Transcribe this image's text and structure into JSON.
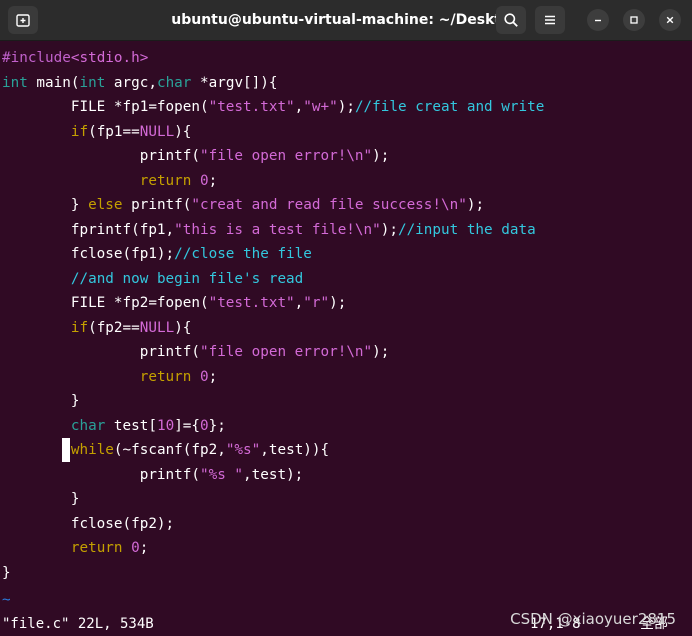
{
  "window": {
    "title": "ubuntu@ubuntu-virtual-machine: ~/Desktop"
  },
  "titlebar_buttons": {
    "new_tab": "new-tab-icon",
    "search": "search-icon",
    "menu": "hamburger-menu-icon",
    "minimize": "minimize-icon",
    "maximize": "maximize-icon",
    "close": "close-icon"
  },
  "code_lines": [
    {
      "parts": [
        [
          "#include",
          "pp"
        ],
        [
          "<stdio.h>",
          "st"
        ]
      ]
    },
    {
      "parts": [
        [
          "int",
          "ty"
        ],
        [
          " main(",
          ""
        ],
        [
          "int",
          "ty"
        ],
        [
          " argc,",
          ""
        ],
        [
          "char",
          "ty"
        ],
        [
          " *argv[]){",
          ""
        ]
      ]
    },
    {
      "parts": [
        [
          "        FILE *fp1=fopen(",
          ""
        ],
        [
          "\"test.txt\"",
          "st"
        ],
        [
          ",",
          ""
        ],
        [
          "\"w+\"",
          "st"
        ],
        [
          ");",
          ""
        ],
        [
          "//file creat and write",
          "cm"
        ]
      ]
    },
    {
      "parts": [
        [
          "        ",
          ""
        ],
        [
          "if",
          "kw"
        ],
        [
          "(fp1==",
          ""
        ],
        [
          "NULL",
          "st"
        ],
        [
          "){",
          ""
        ]
      ]
    },
    {
      "parts": [
        [
          "                printf(",
          ""
        ],
        [
          "\"file open error!",
          "st"
        ],
        [
          "\\n",
          "st"
        ],
        [
          "\"",
          "st"
        ],
        [
          ");",
          ""
        ]
      ]
    },
    {
      "parts": [
        [
          "                ",
          ""
        ],
        [
          "return",
          "kw"
        ],
        [
          " ",
          ""
        ],
        [
          "0",
          "st"
        ],
        [
          ";",
          ""
        ]
      ]
    },
    {
      "parts": [
        [
          "        } ",
          ""
        ],
        [
          "else",
          "kw"
        ],
        [
          " printf(",
          ""
        ],
        [
          "\"creat and read file success!",
          "st"
        ],
        [
          "\\n",
          "st"
        ],
        [
          "\"",
          "st"
        ],
        [
          ");",
          ""
        ]
      ]
    },
    {
      "parts": [
        [
          "        fprintf(fp1,",
          ""
        ],
        [
          "\"this is a test file!",
          "st"
        ],
        [
          "\\n",
          "st"
        ],
        [
          "\"",
          "st"
        ],
        [
          ");",
          ""
        ],
        [
          "//input the data",
          "cm"
        ]
      ]
    },
    {
      "parts": [
        [
          "        fclose(fp1);",
          ""
        ],
        [
          "//close the file",
          "cm"
        ]
      ]
    },
    {
      "parts": [
        [
          "        ",
          ""
        ],
        [
          "//and now begin file's read",
          "cm"
        ]
      ]
    },
    {
      "parts": [
        [
          "        FILE *fp2=fopen(",
          ""
        ],
        [
          "\"test.txt\"",
          "st"
        ],
        [
          ",",
          ""
        ],
        [
          "\"r\"",
          "st"
        ],
        [
          ");",
          ""
        ]
      ]
    },
    {
      "parts": [
        [
          "        ",
          ""
        ],
        [
          "if",
          "kw"
        ],
        [
          "(fp2==",
          ""
        ],
        [
          "NULL",
          "st"
        ],
        [
          "){",
          ""
        ]
      ]
    },
    {
      "parts": [
        [
          "                printf(",
          ""
        ],
        [
          "\"file open error!",
          "st"
        ],
        [
          "\\n",
          "st"
        ],
        [
          "\"",
          "st"
        ],
        [
          ");",
          ""
        ]
      ]
    },
    {
      "parts": [
        [
          "                ",
          ""
        ],
        [
          "return",
          "kw"
        ],
        [
          " ",
          ""
        ],
        [
          "0",
          "st"
        ],
        [
          ";",
          ""
        ]
      ]
    },
    {
      "parts": [
        [
          "        }",
          ""
        ]
      ]
    },
    {
      "parts": [
        [
          "        ",
          ""
        ],
        [
          "char",
          "ty"
        ],
        [
          " test[",
          ""
        ],
        [
          "10",
          "st"
        ],
        [
          "]={",
          ""
        ],
        [
          "0",
          "st"
        ],
        [
          "};",
          ""
        ]
      ]
    },
    {
      "parts": [
        [
          "        ",
          ""
        ],
        [
          "while",
          "kw"
        ],
        [
          "(~fscanf(fp2,",
          ""
        ],
        [
          "\"%s\"",
          "st"
        ],
        [
          ",test)){",
          ""
        ]
      ]
    },
    {
      "parts": [
        [
          "                printf(",
          ""
        ],
        [
          "\"%s \"",
          "st"
        ],
        [
          ",test);",
          ""
        ]
      ]
    },
    {
      "parts": [
        [
          "        }",
          ""
        ]
      ]
    },
    {
      "parts": [
        [
          "        fclose(fp2);",
          ""
        ]
      ]
    },
    {
      "parts": [
        [
          "        ",
          ""
        ],
        [
          "return",
          "kw"
        ],
        [
          " ",
          ""
        ],
        [
          "0",
          "st"
        ],
        [
          ";",
          ""
        ]
      ]
    },
    {
      "parts": [
        [
          "}",
          ""
        ]
      ]
    }
  ],
  "tilde_line": "~",
  "status_line": {
    "file_info": "\"file.c\" 22L, 534B",
    "cursor_position": "17,1-8",
    "scroll_position": "全部"
  },
  "watermark": "CSDN @xiaoyuer2815"
}
